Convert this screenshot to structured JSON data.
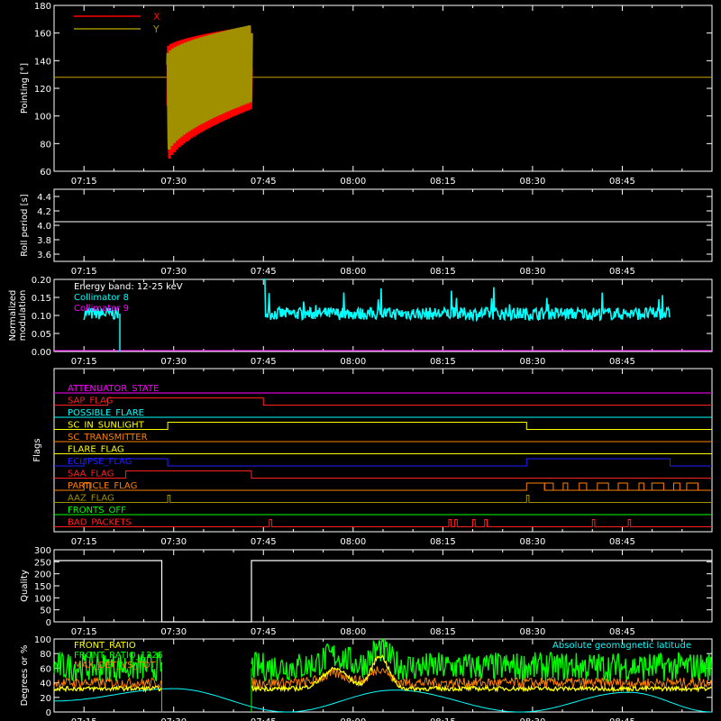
{
  "time_ticks": [
    "07:15",
    "07:30",
    "07:45",
    "08:00",
    "08:15",
    "08:30",
    "08:45"
  ],
  "time_range_minutes": [
    430,
    540
  ],
  "chart_data": [
    {
      "type": "line",
      "ylabel": "Pointing [°]",
      "ylim": [
        60,
        180
      ],
      "yticks": [
        60,
        80,
        100,
        120,
        140,
        160,
        180
      ],
      "legend": [
        "X",
        "Y"
      ],
      "series": [
        {
          "name": "X",
          "color": "#ff0000",
          "span": [
            "07:29",
            "07:43"
          ],
          "upper_envelope": [
            [
              449,
              150
            ],
            [
              463,
              165
            ]
          ],
          "lower_envelope": [
            [
              449,
              65
            ],
            [
              463,
              105
            ]
          ]
        },
        {
          "name": "Y",
          "color": "#a09000",
          "span": [
            "07:29",
            "07:43"
          ],
          "upper_envelope": [
            [
              449,
              145
            ],
            [
              463,
              166
            ]
          ],
          "lower_envelope": [
            [
              449,
              72
            ],
            [
              463,
              110
            ]
          ]
        }
      ],
      "reference_line": 128
    },
    {
      "type": "line",
      "ylabel": "Roll period [s]",
      "ylim": [
        3.5,
        4.5
      ],
      "yticks": [
        "3.6",
        "3.8",
        "4.0",
        "4.2",
        "4.4"
      ],
      "series": [
        {
          "name": "",
          "color": "#ffffff",
          "value": 4.05
        }
      ]
    },
    {
      "type": "line",
      "ylabel": "Normalized modulation",
      "ylim": [
        0,
        0.2
      ],
      "yticks": [
        "0.00",
        "0.05",
        "0.10",
        "0.15",
        "0.20"
      ],
      "annotation": "Energy band: 12-25 keV",
      "legend": [
        "Collimator 8",
        "Collimator 9"
      ],
      "series": [
        {
          "name": "Collimator 8",
          "color": "#00ffff",
          "segments": [
            [
              "07:15",
              "07:21"
            ],
            [
              "07:45",
              "08:53"
            ]
          ],
          "mean": 0.105
        },
        {
          "name": "Collimator 9",
          "color": "#ff00ff",
          "value": 0.0
        }
      ]
    },
    {
      "type": "flags",
      "ylabel": "Flags",
      "flags": [
        {
          "label": "ATTENUATOR_STATE",
          "color": "#ff00ff",
          "on": []
        },
        {
          "label": "SAP_FLAG",
          "color": "#ff2020",
          "on": [
            [
              "07:19",
              "07:45"
            ]
          ]
        },
        {
          "label": "POSSIBLE_FLARE",
          "color": "#00ffff",
          "on": []
        },
        {
          "label": "SC_IN_SUNLIGHT",
          "color": "#ffff00",
          "on": [
            [
              "07:29",
              "08:29"
            ]
          ]
        },
        {
          "label": "SC_TRANSMITTER",
          "color": "#ff7f00",
          "on": []
        },
        {
          "label": "FLARE_FLAG",
          "color": "#ffff00",
          "on": []
        },
        {
          "label": "ECLIPSE_FLAG",
          "color": "#2020ff",
          "on": [
            [
              "07:15",
              "07:29"
            ],
            [
              "08:29",
              "08:53"
            ]
          ]
        },
        {
          "label": "SAA_FLAG",
          "color": "#ff2020",
          "on": [
            [
              "07:22",
              "07:43"
            ]
          ]
        },
        {
          "label": "PARTICLE_FLAG",
          "color": "#ff7f00",
          "on": [
            [
              "07:15",
              "07:16"
            ],
            [
              "08:29",
              "08:32"
            ]
          ]
        },
        {
          "label": "AAZ_FLAG",
          "color": "#a09000",
          "on": [
            [
              "07:29",
              "07:29"
            ],
            [
              "08:29",
              "08:29"
            ]
          ]
        },
        {
          "label": "FRONTS_OFF",
          "color": "#00ff00",
          "on": []
        },
        {
          "label": "BAD_PACKETS",
          "color": "#ff2020",
          "on": [
            [
              "07:46",
              "07:46"
            ],
            [
              "08:16",
              "08:16"
            ],
            [
              "08:17",
              "08:17"
            ],
            [
              "08:20",
              "08:20"
            ],
            [
              "08:22",
              "08:22"
            ],
            [
              "08:40",
              "08:40"
            ],
            [
              "08:46",
              "08:46"
            ]
          ]
        }
      ]
    },
    {
      "type": "line",
      "ylabel": "Quality",
      "ylim": [
        0,
        300
      ],
      "yticks": [
        0,
        50,
        100,
        150,
        200,
        250,
        300
      ],
      "series": [
        {
          "name": "",
          "color": "#ffffff",
          "steps": [
            [
              430,
              255
            ],
            [
              448,
              255
            ],
            [
              448,
              0
            ],
            [
              463,
              0
            ],
            [
              463,
              255
            ],
            [
              540,
              255
            ]
          ]
        }
      ]
    },
    {
      "type": "line",
      "ylabel": "Degrees or %",
      "ylim": [
        0,
        100
      ],
      "yticks": [
        0,
        20,
        40,
        60,
        80,
        100
      ],
      "legend": [
        "FRONT_RATIO",
        "FRONT_RATIO_1225",
        "MAX_DET_VS_TOT"
      ],
      "right_legend": "Absolute geomagnetic latitude",
      "series": [
        {
          "name": "FRONT_RATIO",
          "color": "#ffff00",
          "level": 32
        },
        {
          "name": "FRONT_RATIO_1225",
          "color": "#00ff00",
          "level": 62
        },
        {
          "name": "MAX_DET_VS_TOT",
          "color": "#ff7f00",
          "level": 55
        },
        {
          "name": "Absolute geomagnetic latitude",
          "color": "#00ffff",
          "peaks": [
            [
              450,
              32
            ],
            [
              487,
              30
            ],
            [
              526,
              27
            ]
          ],
          "troughs": [
            [
              430,
              15
            ],
            [
              469,
              0
            ],
            [
              508,
              0
            ],
            [
              540,
              0
            ]
          ]
        }
      ]
    }
  ]
}
